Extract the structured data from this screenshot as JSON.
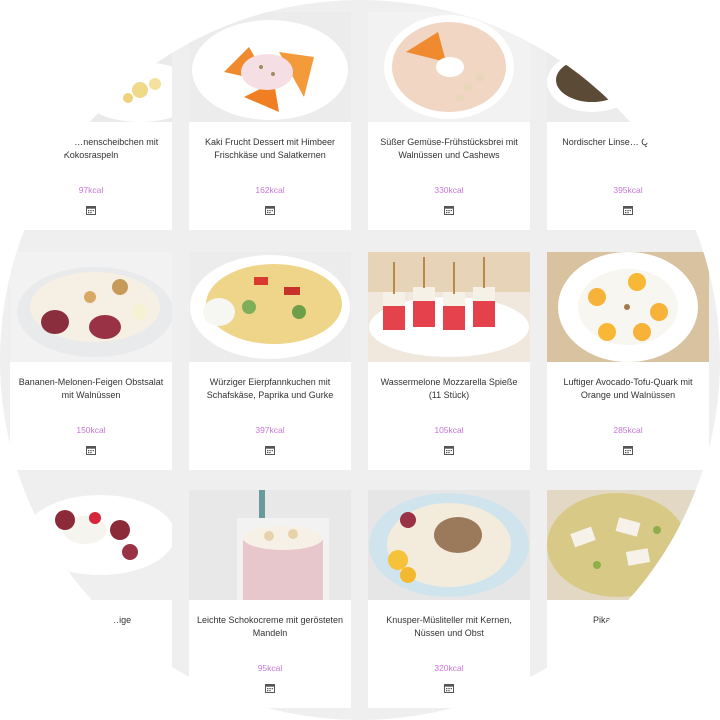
{
  "recipes": [
    {
      "title": "…ebackene …nenscheibchen mit Kokosraspeln",
      "kcal": "97kcal",
      "image": "baked-banana-slices"
    },
    {
      "title": "Kaki Frucht Dessert mit Himbeer Frischkäse und Salatkernen",
      "kcal": "162kcal",
      "image": "persimmon-dessert"
    },
    {
      "title": "Süßer Gemüse-Frühstücksbrei mit Walnüssen und Cashews",
      "kcal": "330kcal",
      "image": "porridge-bowl"
    },
    {
      "title": "Nordischer Linse… Quinoa-Salat",
      "kcal": "395kcal",
      "image": "lentil-quinoa-salad"
    },
    {
      "title": "Bananen-Melonen-Feigen Obstsalat mit Walnüssen",
      "kcal": "150kcal",
      "image": "fig-fruit-salad"
    },
    {
      "title": "Würziger Eierpfannkuchen mit Schafskäse, Paprika und Gurke",
      "kcal": "397kcal",
      "image": "omelette-plate"
    },
    {
      "title": "Wassermelone Mozzarella Spieße (11 Stück)",
      "kcal": "105kcal",
      "image": "watermelon-skewers"
    },
    {
      "title": "Luftiger Avocado-Tofu-Quark mit Orange und Walnüssen",
      "kcal": "285kcal",
      "image": "orange-quark-plate"
    },
    {
      "title": "…Obst-Traum …ige",
      "kcal": "",
      "image": "fig-cream-plate"
    },
    {
      "title": "Leichte Schokocreme mit gerösteten Mandeln",
      "kcal": "95kcal",
      "image": "chocolate-cream-glass"
    },
    {
      "title": "Knusper-Müsliteller mit Kernen, Nüssen und Obst",
      "kcal": "320kcal",
      "image": "muesli-plate"
    },
    {
      "title": "Pikante… Ome…",
      "kcal": "",
      "image": "zucchini-omelette"
    }
  ],
  "icons": {
    "calendar": "calendar-icon"
  },
  "colors": {
    "kcal": "#c678d6",
    "background": "#efefef",
    "card": "#ffffff",
    "title": "#333333"
  }
}
